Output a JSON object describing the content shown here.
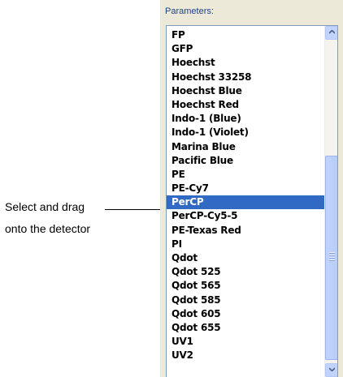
{
  "parameters_panel": {
    "header": "Parameters:",
    "items": [
      {
        "label": "FP",
        "selected": false
      },
      {
        "label": "GFP",
        "selected": false
      },
      {
        "label": "Hoechst",
        "selected": false
      },
      {
        "label": "Hoechst 33258",
        "selected": false
      },
      {
        "label": "Hoechst Blue",
        "selected": false
      },
      {
        "label": "Hoechst Red",
        "selected": false
      },
      {
        "label": "Indo-1 (Blue)",
        "selected": false
      },
      {
        "label": "Indo-1 (Violet)",
        "selected": false
      },
      {
        "label": "Marina Blue",
        "selected": false
      },
      {
        "label": "Pacific Blue",
        "selected": false
      },
      {
        "label": "PE",
        "selected": false
      },
      {
        "label": "PE-Cy7",
        "selected": false
      },
      {
        "label": "PerCP",
        "selected": true
      },
      {
        "label": "PerCP-Cy5-5",
        "selected": false
      },
      {
        "label": "PE-Texas Red",
        "selected": false
      },
      {
        "label": "PI",
        "selected": false
      },
      {
        "label": "Qdot",
        "selected": false
      },
      {
        "label": "Qdot 525",
        "selected": false
      },
      {
        "label": "Qdot 565",
        "selected": false
      },
      {
        "label": "Qdot 585",
        "selected": false
      },
      {
        "label": "Qdot 605",
        "selected": false
      },
      {
        "label": "Qdot 655",
        "selected": false
      },
      {
        "label": "UV1",
        "selected": false
      },
      {
        "label": "UV2",
        "selected": false
      }
    ]
  },
  "callout": {
    "line1": "Select and drag",
    "line2": "onto the detector"
  },
  "colors": {
    "selection": "#316ac5",
    "panel_background": "#ece9d8",
    "header_text": "#1d3f8a"
  },
  "icons": {
    "scroll_up": "scroll-up-arrow-icon",
    "scroll_down": "scroll-down-arrow-icon"
  }
}
